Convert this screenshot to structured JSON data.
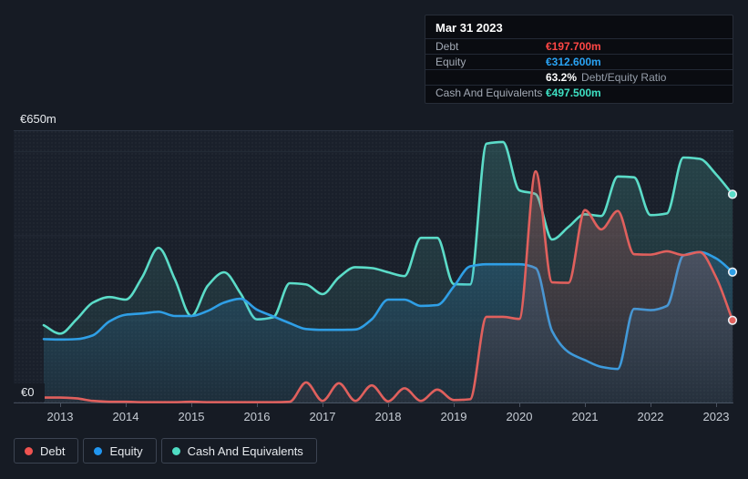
{
  "page": {
    "bg": "#161b24"
  },
  "y_axis": {
    "top_label": "€650m",
    "zero_label": "€0"
  },
  "x_axis": {
    "years": [
      "2013",
      "2014",
      "2015",
      "2016",
      "2017",
      "2018",
      "2019",
      "2020",
      "2021",
      "2022",
      "2023"
    ]
  },
  "legend": {
    "items": [
      {
        "label": "Debt",
        "color": "#ef5350"
      },
      {
        "label": "Equity",
        "color": "#2196f0"
      },
      {
        "label": "Cash And Equivalents",
        "color": "#4fdcc3"
      }
    ]
  },
  "tooltip": {
    "date": "Mar 31 2023",
    "rows": [
      {
        "label": "Debt",
        "value": "€197.700m",
        "color": "#ff4745"
      },
      {
        "label": "Equity",
        "value": "€312.600m",
        "color": "#2aa3f4"
      }
    ],
    "ratio": {
      "pct": "63.2%",
      "label": "Debt/Equity Ratio"
    },
    "cash_row": {
      "label": "Cash And Equivalents",
      "value": "€497.500m",
      "color": "#3ee0c3"
    }
  },
  "chart_data": {
    "type": "area",
    "title": "",
    "xlabel": "",
    "ylabel": "",
    "x_start": 2012.75,
    "x_step": 0.25,
    "x_ticks": [
      2013,
      2014,
      2015,
      2016,
      2017,
      2018,
      2019,
      2020,
      2021,
      2022,
      2023
    ],
    "ylim": [
      0,
      650
    ],
    "y_grid_values": [
      600,
      400,
      200
    ],
    "y_axis_labels": {
      "max": "€650m",
      "min": "€0"
    },
    "grid": true,
    "legend_position": "bottom-left",
    "end_markers": true,
    "units": "€m",
    "series": [
      {
        "name": "Debt",
        "color": "#e0605d",
        "values": [
          14,
          14,
          12,
          6,
          4,
          4,
          3,
          3,
          3,
          4,
          3,
          3,
          3,
          3,
          3,
          4,
          50,
          6,
          48,
          6,
          43,
          5,
          36,
          6,
          33,
          8,
          10,
          206,
          206,
          201,
          552,
          288,
          287,
          460,
          414,
          458,
          355,
          354,
          362,
          353,
          360,
          300,
          197.7
        ]
      },
      {
        "name": "Equity",
        "color": "#2f9fe6",
        "values": [
          153,
          152,
          153,
          162,
          195,
          211,
          214,
          218,
          208,
          208,
          220,
          240,
          249,
          223,
          207,
          191,
          177,
          175,
          175,
          176,
          200,
          247,
          247,
          232,
          234,
          278,
          326,
          331,
          331,
          331,
          322,
          172,
          122,
          103,
          87,
          82,
          225,
          222,
          232,
          352,
          360,
          345,
          312.6
        ]
      },
      {
        "name": "Cash And Equivalents",
        "color": "#5bdcc8",
        "values": [
          186,
          166,
          200,
          240,
          253,
          247,
          300,
          370,
          295,
          208,
          280,
          312,
          262,
          200,
          205,
          286,
          283,
          260,
          300,
          324,
          322,
          312,
          303,
          394,
          394,
          284,
          283,
          618,
          622,
          507,
          498,
          390,
          420,
          450,
          446,
          540,
          538,
          448,
          452,
          585,
          582,
          545,
          497.5
        ]
      }
    ]
  }
}
